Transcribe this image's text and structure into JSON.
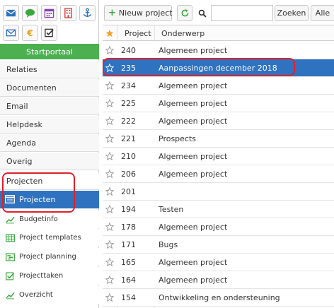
{
  "sidebar": {
    "icons": [
      "mail-icon",
      "chat-icon",
      "calendar-icon",
      "building-icon",
      "anchor-icon",
      "envelope-icon",
      "euro-icon",
      "checkbox-icon"
    ],
    "portal_label": "Startportaal",
    "nav": [
      {
        "label": "Relaties"
      },
      {
        "label": "Documenten"
      },
      {
        "label": "Email"
      },
      {
        "label": "Helpdesk"
      },
      {
        "label": "Agenda"
      },
      {
        "label": "Overig"
      },
      {
        "label": "Projecten"
      }
    ],
    "active_item": {
      "label": "Projecten",
      "icon": "window-icon"
    },
    "sub_items": [
      {
        "label": "Budgetinfo",
        "icon": "trend-icon"
      },
      {
        "label": "Project templates",
        "icon": "table-icon"
      },
      {
        "label": "Project planning",
        "icon": "planning-icon"
      },
      {
        "label": "Projecttaken",
        "icon": "check-icon"
      },
      {
        "label": "Overzicht",
        "icon": "trend-icon"
      }
    ]
  },
  "toolbar": {
    "new_project_label": "Nieuw project",
    "search_button_label": "Zoeken",
    "all_button_label": "Alle",
    "search_value": ""
  },
  "table": {
    "columns": {
      "project": "Project",
      "subject": "Onderwerp"
    },
    "rows": [
      {
        "project": "240",
        "subject": "Algemeen project",
        "selected": false
      },
      {
        "project": "235",
        "subject": "Aanpassingen december 2018",
        "selected": true
      },
      {
        "project": "234",
        "subject": "Algemeen project",
        "selected": false
      },
      {
        "project": "225",
        "subject": "Algemeen project",
        "selected": false
      },
      {
        "project": "222",
        "subject": "Algemeen project",
        "selected": false
      },
      {
        "project": "221",
        "subject": "Prospects",
        "selected": false
      },
      {
        "project": "210",
        "subject": "Algemeen project",
        "selected": false
      },
      {
        "project": "206",
        "subject": "Algemeen project",
        "selected": false
      },
      {
        "project": "201",
        "subject": "",
        "selected": false
      },
      {
        "project": "194",
        "subject": "Testen",
        "selected": false
      },
      {
        "project": "178",
        "subject": "Algemeen project",
        "selected": false
      },
      {
        "project": "171",
        "subject": "Bugs",
        "selected": false
      },
      {
        "project": "165",
        "subject": "Algemeen project",
        "selected": false
      },
      {
        "project": "164",
        "subject": "Algemeen project",
        "selected": false
      },
      {
        "project": "154",
        "subject": "Ontwikkeling en ondersteuning",
        "selected": false
      }
    ]
  },
  "colors": {
    "accent_blue": "#2f72bf",
    "portal_green": "#4caf50",
    "annotation_red": "#e0202a",
    "star_header": "#f0a020"
  }
}
